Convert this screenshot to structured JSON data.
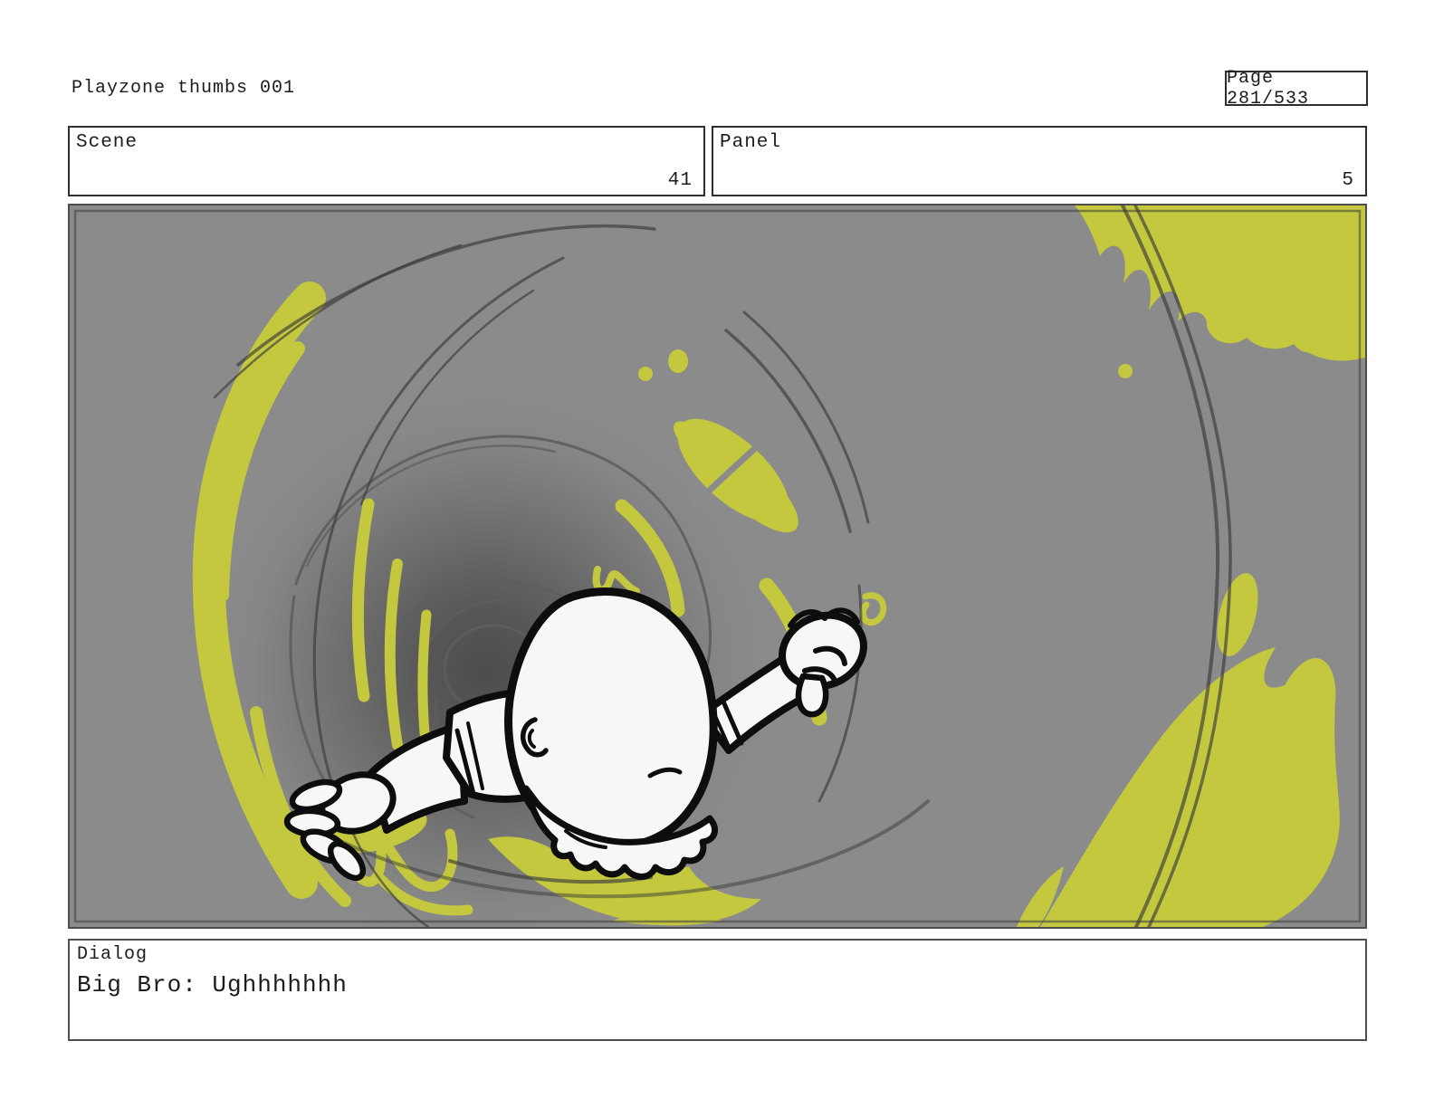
{
  "header": {
    "title": "Playzone thumbs 001",
    "page_label": "Page 281/533"
  },
  "scene": {
    "label": "Scene",
    "value": "41"
  },
  "panel": {
    "label": "Panel",
    "value": "5"
  },
  "dialog": {
    "label": "Dialog",
    "text": "Big Bro: Ughhhhhhh"
  },
  "artwork": {
    "description": "Character with outstretched arms falling head-first into a swirling vortex tunnel, yellow-green motion streaks and splashes around the spiral",
    "colors": {
      "background": "#8b8b8b",
      "accent_yellow": "#c3c83e",
      "sketch_line": "#5e5e5e",
      "tunnel_dark": "#4d4d4d",
      "character_fill": "#f7f7f5",
      "character_outline": "#0d0d0d"
    }
  }
}
